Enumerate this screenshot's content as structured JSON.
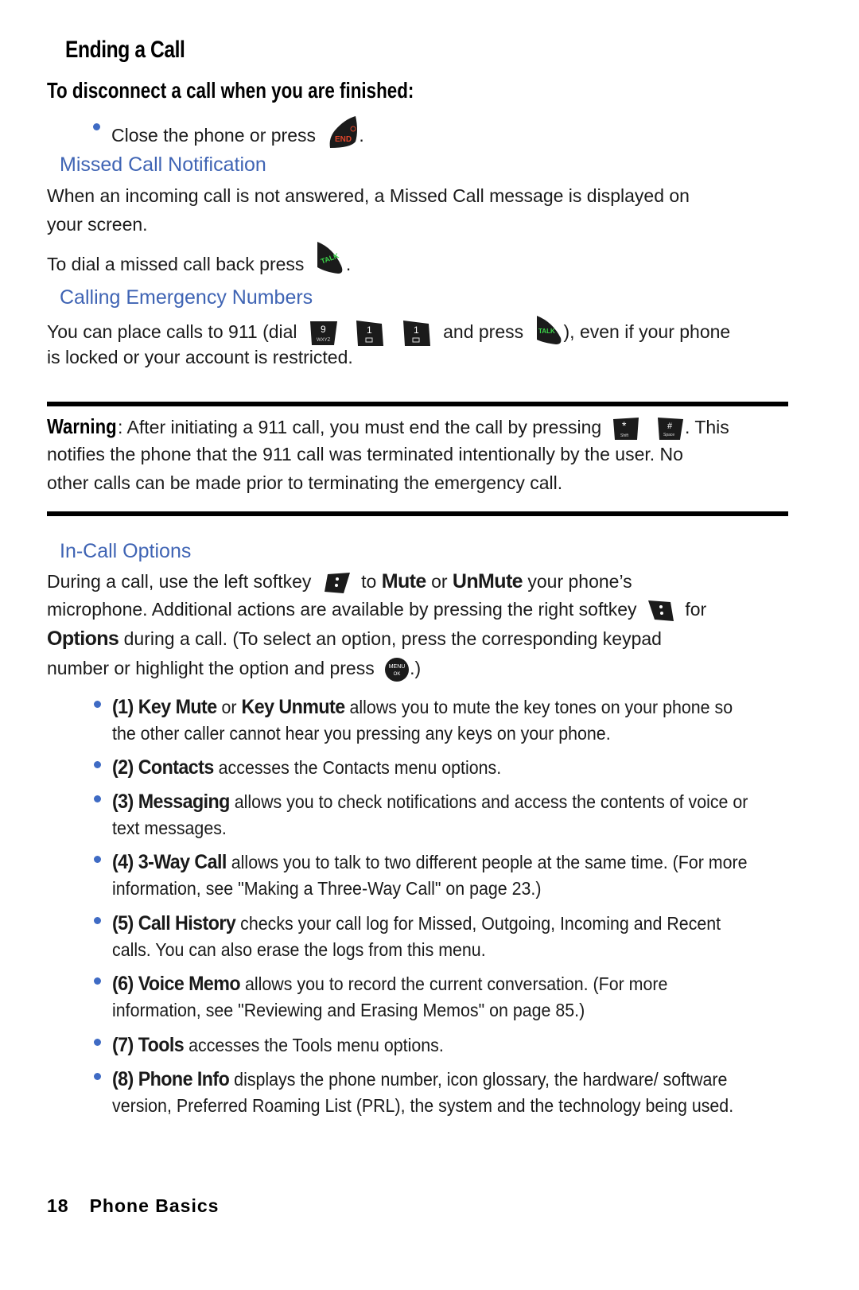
{
  "page": {
    "title": "Ending a Call",
    "subtitle": "To disconnect a call when you are finished:",
    "end_bullet": {
      "text": "Close the phone or press",
      "key": "END",
      "after": "."
    },
    "missed": {
      "heading": "Missed Call Notification",
      "para1_line1": "When an incoming call is not answered, a Missed Call message is displayed on",
      "para1_line2": "your screen.",
      "para2": "To dial a missed call back press",
      "para2_key": "TALK",
      "para2_after": "."
    },
    "emergency": {
      "heading": "Calling Emergency Numbers",
      "line1_before": "You can place calls to 911 (dial",
      "keys": [
        {
          "main": "9",
          "sub": "WXYZ"
        },
        {
          "main": "1",
          "sub": "✉"
        },
        {
          "main": "1",
          "sub": "✉"
        }
      ],
      "line1_mid": "and press",
      "talk_key": "TALK",
      "line1_after": "), even if your phone",
      "line2": "is locked or your account is restricted."
    },
    "warning": {
      "label": "Warning",
      "line1": ": After initiating a 911 call, you must end the call by pressing",
      "keys": [
        {
          "main": "*",
          "sub": "Shift"
        },
        {
          "main": "#",
          "sub": "Space"
        }
      ],
      "line1_after": ". This",
      "line2": "notifies the phone that the 911 call was terminated intentionally by the user. No",
      "line3": "other calls can be made prior to terminating the emergency call."
    },
    "incall": {
      "heading": "In-Call Options",
      "l1_a": "During a call, use the left softkey",
      "l1_b": "to",
      "l1_mute": "Mute",
      "l1_or": "or",
      "l1_unmute": "UnMute",
      "l1_c": "your phone’s",
      "l2_a": "microphone. Additional actions are available by pressing the right softkey",
      "l2_b": "for",
      "l3_options": "Options",
      "l3_rest": "during a call. (To select an option, press the corresponding keypad",
      "l4": "number or highlight the option and press",
      "l4_key_top": "MENU",
      "l4_key_bottom": "OK",
      "l4_after": ".)"
    },
    "options": [
      {
        "num": "(1)",
        "bold1": "Key Mute",
        "mid": "or",
        "bold2": "Key Unmute",
        "text": "allows you to mute the key tones on your phone so the other caller cannot hear you pressing any keys on your phone."
      },
      {
        "num": "(2)",
        "bold1": "Contacts",
        "text": "accesses the Contacts menu options."
      },
      {
        "num": "(3)",
        "bold1": "Messaging",
        "text": "allows you to check notifications and access the contents of voice or text messages."
      },
      {
        "num": "(4)",
        "bold1": "3-Way Call",
        "text": "allows you to talk to two different people at the same time. (For more information, see \"Making a Three-Way Call\" on page 23.)"
      },
      {
        "num": "(5)",
        "bold1": "Call History",
        "text": "checks your call log for Missed, Outgoing, Incoming and Recent calls. You can also erase the logs from this menu."
      },
      {
        "num": "(6)",
        "bold1": "Voice Memo",
        "text": "allows you to record the current conversation. (For more information, see \"Reviewing and Erasing Memos\" on page 85.)"
      },
      {
        "num": "(7)",
        "bold1": "Tools",
        "text": "accesses the Tools menu options."
      },
      {
        "num": "(8)",
        "bold1": "Phone Info",
        "text": "displays the phone number, icon glossary, the hardware/ software version, Preferred Roaming List (PRL), the system and the technology being used."
      }
    ],
    "footer": {
      "page_number": "18",
      "section": "Phone Basics"
    },
    "colors": {
      "heading_blue": "#3f64b4",
      "bullet_blue": "#3f6bc4",
      "end_red": "#e0452a",
      "talk_green": "#3cd84a"
    }
  }
}
